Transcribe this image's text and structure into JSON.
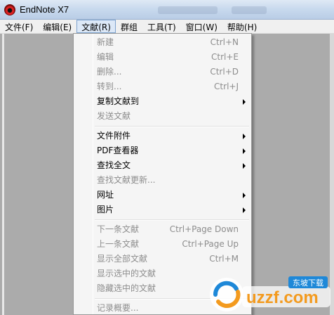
{
  "window": {
    "title": "EndNote X7"
  },
  "menubar": {
    "items": [
      {
        "label": "文件(F)"
      },
      {
        "label": "编辑(E)"
      },
      {
        "label": "文献(R)"
      },
      {
        "label": "群组"
      },
      {
        "label": "工具(T)"
      },
      {
        "label": "窗口(W)"
      },
      {
        "label": "帮助(H)"
      }
    ]
  },
  "dropdown": {
    "group1": [
      {
        "label": "新建",
        "shortcut": "Ctrl+N"
      },
      {
        "label": "编辑",
        "shortcut": "Ctrl+E"
      },
      {
        "label": "删除...",
        "shortcut": "Ctrl+D"
      },
      {
        "label": "转到...",
        "shortcut": "Ctrl+J"
      },
      {
        "label": "复制文献到"
      },
      {
        "label": "发送文献"
      }
    ],
    "group2": [
      {
        "label": "文件附件"
      },
      {
        "label": "PDF查看器"
      },
      {
        "label": "查找全文"
      },
      {
        "label": "查找文献更新..."
      },
      {
        "label": "网址"
      },
      {
        "label": "图片"
      }
    ],
    "group3": [
      {
        "label": "下一条文献",
        "shortcut": "Ctrl+Page Down"
      },
      {
        "label": "上一条文献",
        "shortcut": "Ctrl+Page Up"
      },
      {
        "label": "显示全部文献",
        "shortcut": "Ctrl+M"
      },
      {
        "label": "显示选中的文献"
      },
      {
        "label": "隐藏选中的文献"
      }
    ],
    "group4": [
      {
        "label": "记录概要..."
      }
    ]
  },
  "watermark": {
    "brand": "uzzf.com",
    "badge": "东坡下载"
  },
  "colors": {
    "menu_active_bg": "#dce8f7",
    "menu_active_border": "#7da2ce",
    "disabled_text": "#8d8d8d",
    "brand_orange": "#f39a1e",
    "brand_blue": "#1e88d8"
  }
}
